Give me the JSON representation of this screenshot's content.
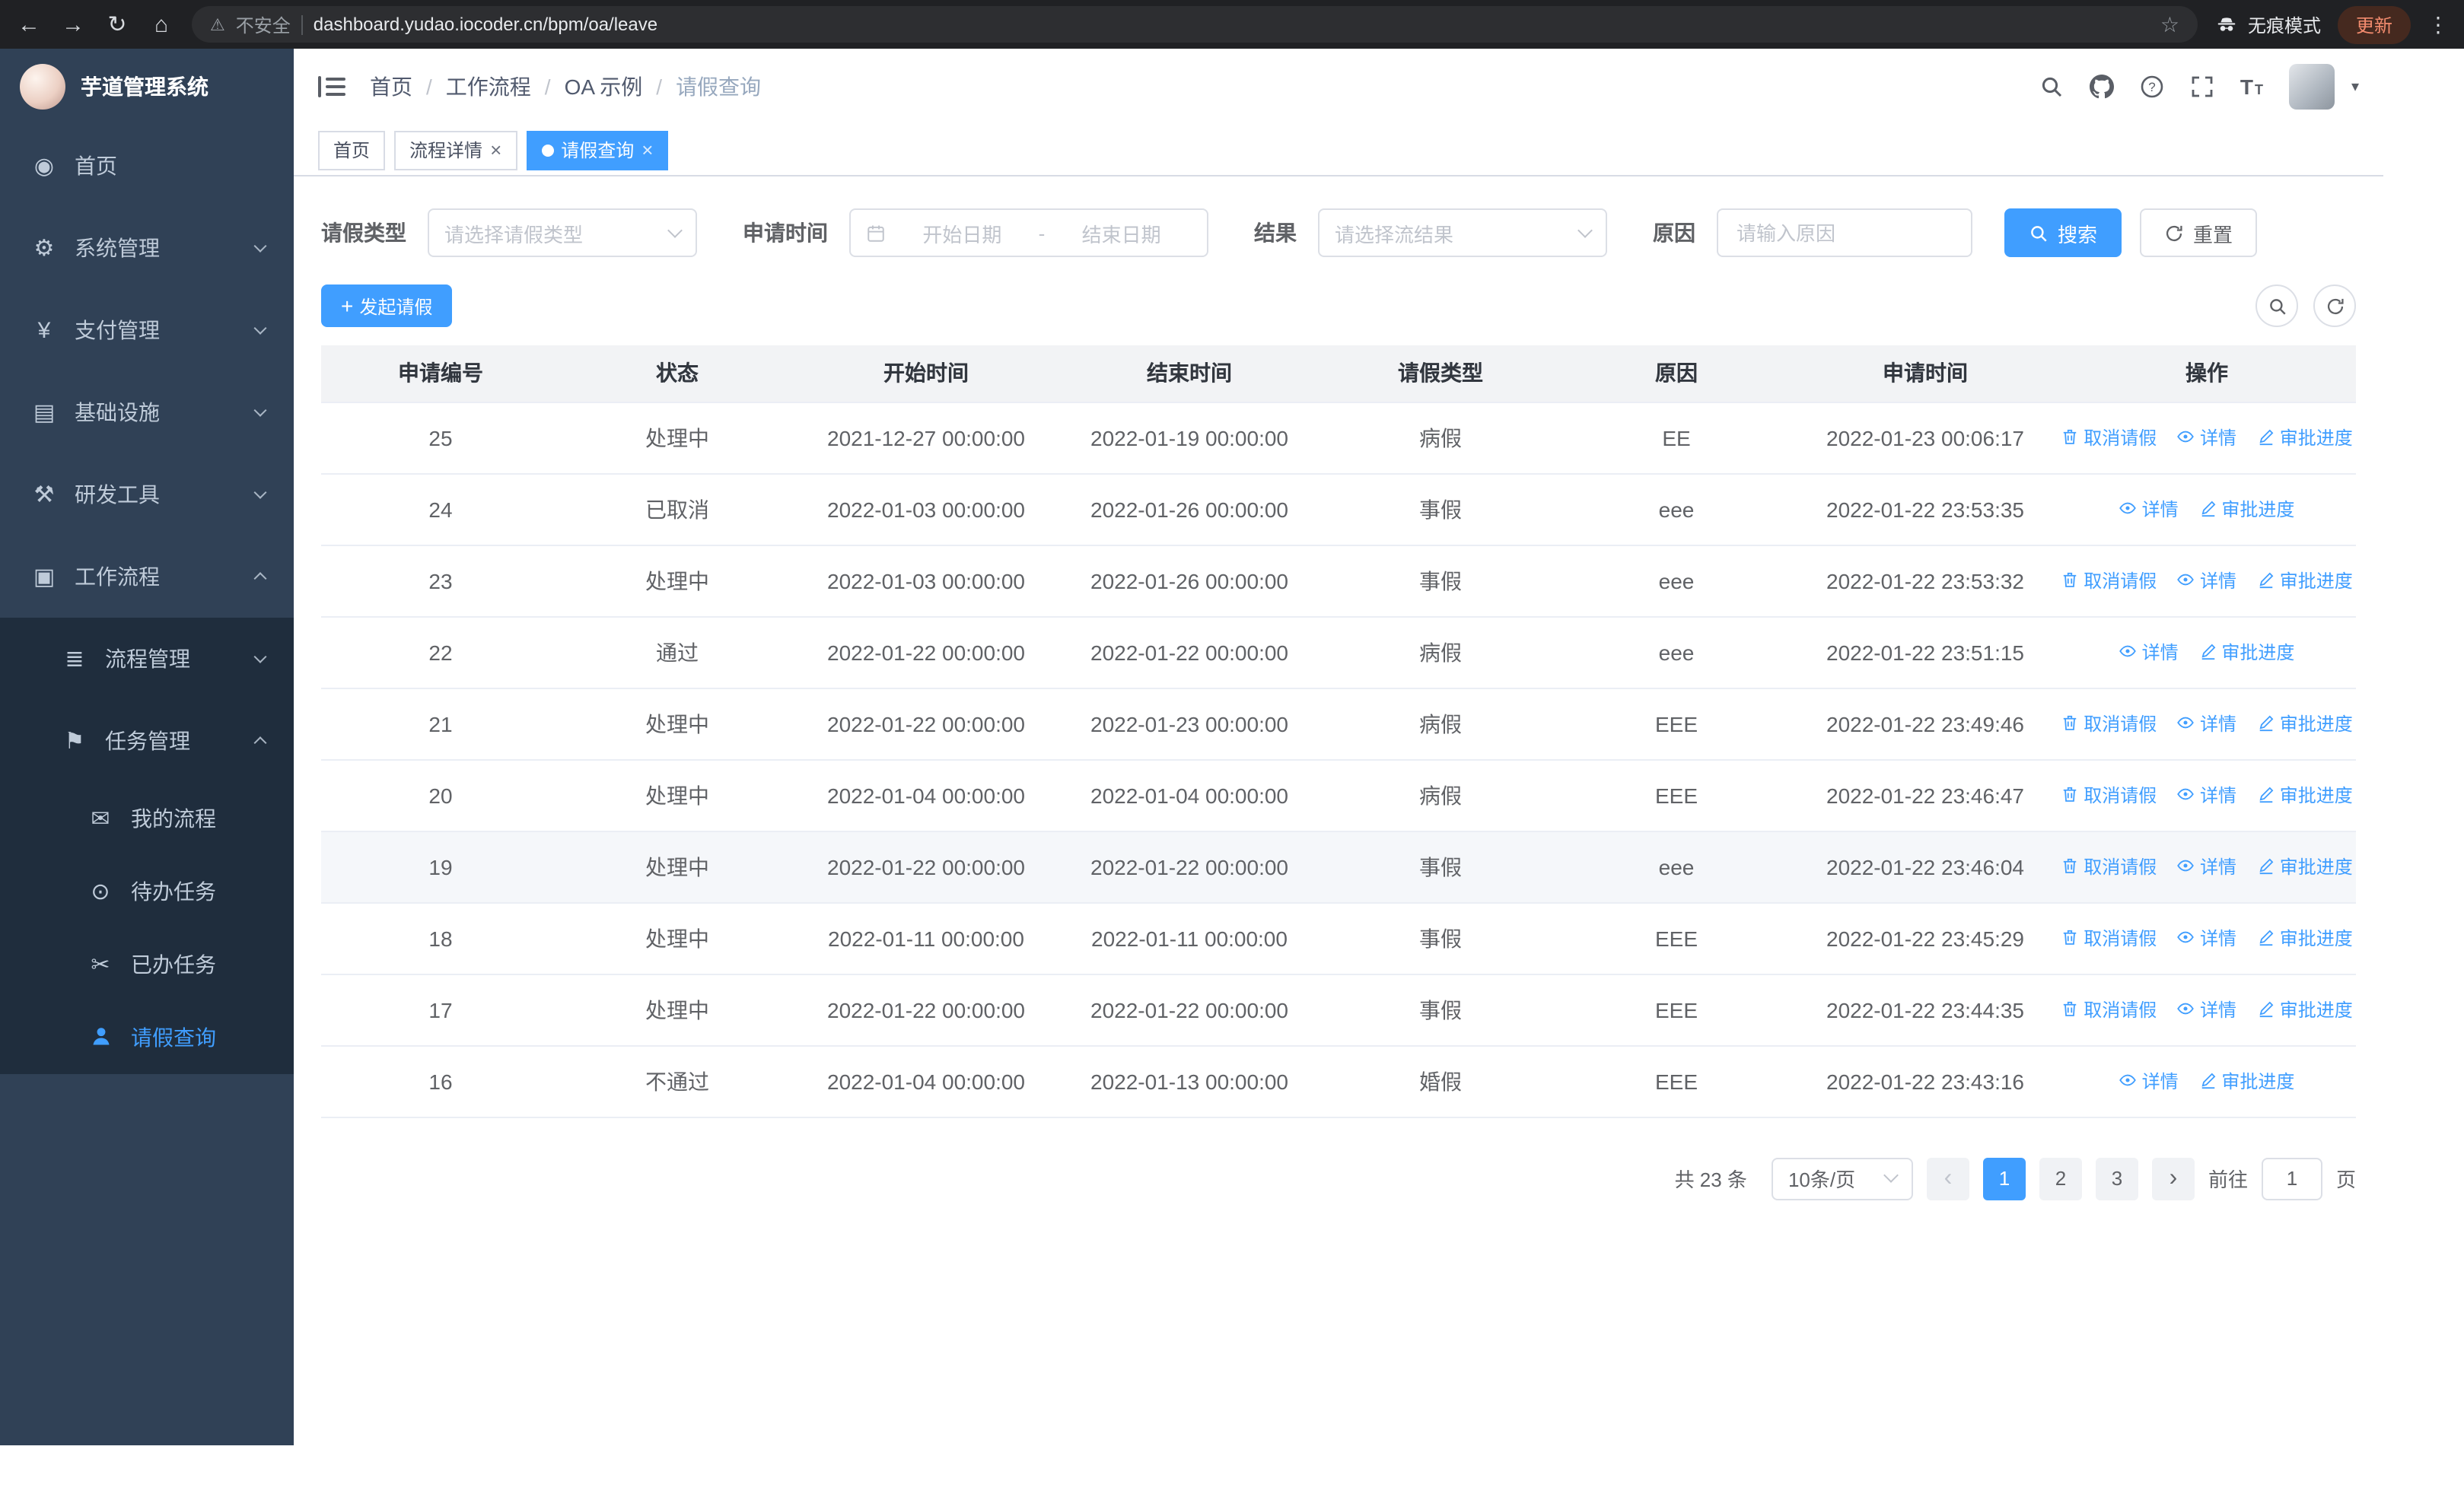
{
  "browser": {
    "security_label": "不安全",
    "url": "dashboard.yudao.iocoder.cn/bpm/oa/leave",
    "incognito_label": "无痕模式",
    "update_label": "更新"
  },
  "icons": {
    "back": "←",
    "forward": "→",
    "reload": "↻",
    "home": "⌂",
    "warning": "⚠",
    "star": "☆",
    "menu_dots": "⋮",
    "caret_down": "▾",
    "close": "×",
    "plus": "+",
    "prev": "‹",
    "next": "›",
    "font_large": "T",
    "font_small": "T"
  },
  "sidebar": {
    "app_title": "芋道管理系统",
    "items": [
      {
        "label": "首页",
        "glyph": "◉"
      },
      {
        "label": "系统管理",
        "glyph": "⚙"
      },
      {
        "label": "支付管理",
        "glyph": "¥"
      },
      {
        "label": "基础设施",
        "glyph": "▤"
      },
      {
        "label": "研发工具",
        "glyph": "⚒"
      },
      {
        "label": "工作流程",
        "glyph": "▣"
      },
      {
        "label": "流程管理",
        "glyph": "≣"
      },
      {
        "label": "任务管理",
        "glyph": "⚑"
      },
      {
        "label": "我的流程",
        "glyph": "✉"
      },
      {
        "label": "待办任务",
        "glyph": "⊙"
      },
      {
        "label": "已办任务",
        "glyph": "✂"
      },
      {
        "label": "请假查询",
        "glyph": ""
      }
    ]
  },
  "breadcrumb": {
    "items": [
      "首页",
      "工作流程",
      "OA 示例",
      "请假查询"
    ]
  },
  "tabs": [
    {
      "label": "首页"
    },
    {
      "label": "流程详情"
    },
    {
      "label": "请假查询"
    }
  ],
  "filters": {
    "type_label": "请假类型",
    "type_placeholder": "请选择请假类型",
    "time_label": "申请时间",
    "start_placeholder": "开始日期",
    "range_separator": "-",
    "end_placeholder": "结束日期",
    "result_label": "结果",
    "result_placeholder": "请选择流结果",
    "reason_label": "原因",
    "reason_placeholder": "请输入原因",
    "search_label": "搜索",
    "reset_label": "重置"
  },
  "toolbar": {
    "create_label": "发起请假"
  },
  "table": {
    "columns": [
      "申请编号",
      "状态",
      "开始时间",
      "结束时间",
      "请假类型",
      "原因",
      "申请时间",
      "操作"
    ],
    "action_labels": {
      "cancel": "取消请假",
      "detail": "详情",
      "progress": "审批进度"
    },
    "rows": [
      {
        "id": "25",
        "status": "处理中",
        "start": "2021-12-27 00:00:00",
        "end": "2022-01-19 00:00:00",
        "type": "病假",
        "reason": "EE",
        "apply": "2022-01-23 00:06:17"
      },
      {
        "id": "24",
        "status": "已取消",
        "start": "2022-01-03 00:00:00",
        "end": "2022-01-26 00:00:00",
        "type": "事假",
        "reason": "eee",
        "apply": "2022-01-22 23:53:35"
      },
      {
        "id": "23",
        "status": "处理中",
        "start": "2022-01-03 00:00:00",
        "end": "2022-01-26 00:00:00",
        "type": "事假",
        "reason": "eee",
        "apply": "2022-01-22 23:53:32"
      },
      {
        "id": "22",
        "status": "通过",
        "start": "2022-01-22 00:00:00",
        "end": "2022-01-22 00:00:00",
        "type": "病假",
        "reason": "eee",
        "apply": "2022-01-22 23:51:15"
      },
      {
        "id": "21",
        "status": "处理中",
        "start": "2022-01-22 00:00:00",
        "end": "2022-01-23 00:00:00",
        "type": "病假",
        "reason": "EEE",
        "apply": "2022-01-22 23:49:46"
      },
      {
        "id": "20",
        "status": "处理中",
        "start": "2022-01-04 00:00:00",
        "end": "2022-01-04 00:00:00",
        "type": "病假",
        "reason": "EEE",
        "apply": "2022-01-22 23:46:47"
      },
      {
        "id": "19",
        "status": "处理中",
        "start": "2022-01-22 00:00:00",
        "end": "2022-01-22 00:00:00",
        "type": "事假",
        "reason": "eee",
        "apply": "2022-01-22 23:46:04"
      },
      {
        "id": "18",
        "status": "处理中",
        "start": "2022-01-11 00:00:00",
        "end": "2022-01-11 00:00:00",
        "type": "事假",
        "reason": "EEE",
        "apply": "2022-01-22 23:45:29"
      },
      {
        "id": "17",
        "status": "处理中",
        "start": "2022-01-22 00:00:00",
        "end": "2022-01-22 00:00:00",
        "type": "事假",
        "reason": "EEE",
        "apply": "2022-01-22 23:44:35"
      },
      {
        "id": "16",
        "status": "不通过",
        "start": "2022-01-04 00:00:00",
        "end": "2022-01-13 00:00:00",
        "type": "婚假",
        "reason": "EEE",
        "apply": "2022-01-22 23:43:16"
      }
    ]
  },
  "pagination": {
    "total": "共 23 条",
    "page_size": "10条/页",
    "pages": [
      "1",
      "2",
      "3"
    ],
    "goto_label": "前往",
    "goto_value": "1",
    "page_label": "页"
  },
  "colors": {
    "primary": "#409eff",
    "sidebar_bg": "#304156",
    "submenu_bg": "#1f2d3d",
    "active_tab_bg": "#409eff",
    "update_text": "#f28b6e"
  }
}
